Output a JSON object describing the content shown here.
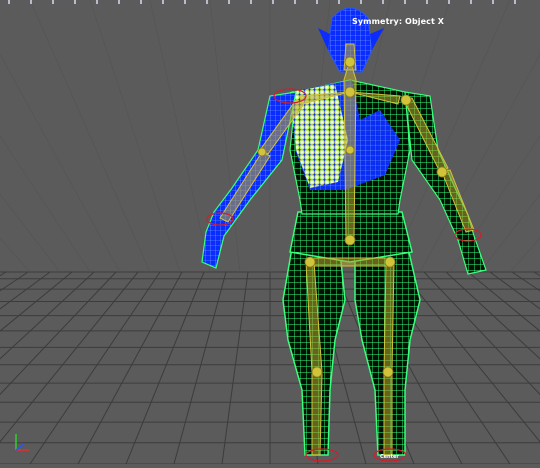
{
  "viewport": {
    "symmetry_label": "Symmetry: Object X",
    "center_label": "Center"
  },
  "colors": {
    "background": "#5b5b5b",
    "grid": "#3c3c3c",
    "wireframe_green": "#39ff7a",
    "weight_blue": "#0b2cff",
    "weight_white": "#f2f2f2",
    "weight_yellow": "#e8f000",
    "weight_red": "#ff2a1f",
    "bone_yellow": "#d2c43a",
    "joint_red": "#d21e2a",
    "axis_x": "#e03030",
    "axis_y": "#30d030",
    "axis_z": "#3050ff"
  }
}
